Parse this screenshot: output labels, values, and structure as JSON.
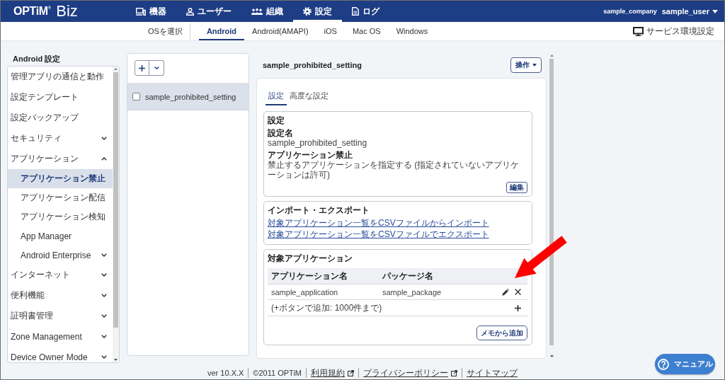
{
  "header": {
    "logo": "OPTiM$^{®}$",
    "product": "Biz",
    "nav": [
      {
        "kind": "devices",
        "label": "機器",
        "selected": false
      },
      {
        "kind": "users",
        "label": "ユーザー",
        "selected": false
      },
      {
        "kind": "organizations",
        "label": "組織",
        "selected": false
      },
      {
        "kind": "settings",
        "label": "設定",
        "selected": true
      },
      {
        "kind": "logs",
        "label": "ログ",
        "selected": false
      }
    ],
    "company": "sample_company",
    "user": "sample_user"
  },
  "os_bar": {
    "label": "OSを選択",
    "tabs": [
      {
        "label": "Android",
        "selected": true
      },
      {
        "label": "Android(AMAPI)",
        "selected": false
      },
      {
        "label": "iOS",
        "selected": false
      },
      {
        "label": "Mac OS",
        "selected": false
      },
      {
        "label": "Windows",
        "selected": false
      }
    ],
    "service_link": "サービス環境設定"
  },
  "sidebar": {
    "title": "Android 設定",
    "items": [
      {
        "kind": "page",
        "label": "管理アプリの通信と動作",
        "selected": false
      },
      {
        "kind": "page",
        "label": "設定テンプレート",
        "selected": false
      },
      {
        "kind": "page",
        "label": "設定バックアップ",
        "selected": false
      },
      {
        "kind": "group",
        "label": "セキュリティ",
        "selected": false,
        "expanded": false
      },
      {
        "kind": "group",
        "label": "アプリケーション",
        "selected": false,
        "expanded": true,
        "children": [
          {
            "kind": "page",
            "label": "アプリケーション禁止",
            "selected": true
          },
          {
            "kind": "page",
            "label": "アプリケーション配信",
            "selected": false
          },
          {
            "kind": "page",
            "label": "アプリケーション検知",
            "selected": false
          },
          {
            "kind": "page",
            "label": "App Manager",
            "selected": false
          },
          {
            "kind": "group",
            "label": "Android Enterprise",
            "selected": false,
            "expanded": false
          }
        ]
      },
      {
        "kind": "group",
        "label": "インターネット",
        "selected": false,
        "expanded": false
      },
      {
        "kind": "group",
        "label": "便利機能",
        "selected": false,
        "expanded": false
      },
      {
        "kind": "group",
        "label": "証明書管理",
        "selected": false,
        "expanded": false
      },
      {
        "kind": "group",
        "label": "Zone Management",
        "selected": false,
        "expanded": false
      },
      {
        "kind": "group",
        "label": "Device Owner Mode",
        "selected": false,
        "expanded": false
      }
    ]
  },
  "settings_list": {
    "items": [
      {
        "label": "sample_prohibited_setting",
        "selected": true,
        "checked": false
      }
    ]
  },
  "detail": {
    "title": "sample_prohibited_setting",
    "actions_button": "操作",
    "tabs": [
      {
        "label": "設定",
        "selected": true
      },
      {
        "label": "高度な設定",
        "selected": false
      }
    ],
    "sections": [
      {
        "kind": "fields",
        "heading": "設定",
        "fields": [
          {
            "label": "設定名",
            "value": "sample_prohibited_setting"
          },
          {
            "label": "アプリケーション禁止",
            "value": "禁止するアプリケーションを指定する (指定されていないアプリケーションは許可)"
          }
        ],
        "button": "編集"
      },
      {
        "kind": "links",
        "heading": "インポート・エクスポート",
        "links": [
          "対象アプリケーション一覧をCSVファイルからインポート",
          "対象アプリケーション一覧をCSVファイルでエクスポート"
        ]
      },
      {
        "kind": "table",
        "heading": "対象アプリケーション",
        "table": {
          "columns": [
            "アプリケーション名",
            "パッケージ名"
          ],
          "rows": [
            [
              "sample_application",
              "sample_package"
            ]
          ],
          "add_hint": "(+ボタンで追加: 1000件まで)"
        },
        "button": "メモから追加"
      }
    ]
  },
  "footer": {
    "items": [
      {
        "kind": "text",
        "text": "ver 10.X.X"
      },
      {
        "kind": "text",
        "text": "©2011 OPTiM"
      },
      {
        "kind": "external_link",
        "text": "利用規約"
      },
      {
        "kind": "external_link",
        "text": "プライバシーポリシー"
      },
      {
        "kind": "link",
        "text": "サイトマップ"
      }
    ]
  },
  "manual_button": "マニュアル"
}
